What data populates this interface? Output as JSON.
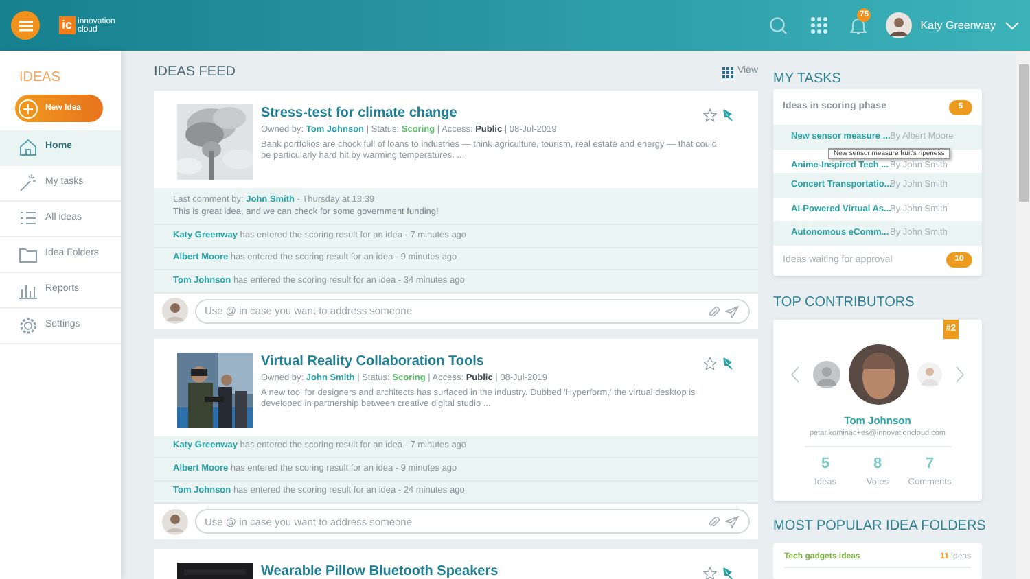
{
  "header": {
    "logo_mark": "ic",
    "logo_text": "innovation cloud",
    "notification_count": "75",
    "user_name": "Katy Greenway"
  },
  "sidebar": {
    "title": "IDEAS",
    "new_button": "New Idea",
    "items": [
      {
        "label": "Home",
        "kind": "home",
        "selected": true
      },
      {
        "label": "My tasks",
        "kind": "tasks",
        "selected": false
      },
      {
        "label": "All ideas",
        "kind": "list",
        "selected": false
      },
      {
        "label": "Idea Folders",
        "kind": "folder",
        "selected": false
      },
      {
        "label": "Reports",
        "kind": "reports",
        "selected": false
      },
      {
        "label": "Settings",
        "kind": "settings",
        "selected": false
      }
    ]
  },
  "feed": {
    "title": "IDEAS FEED",
    "view_label": "View",
    "ideas": [
      {
        "title": "Stress-test for climate change",
        "meta": [
          {
            "kind": "label",
            "text": "Owned by: "
          },
          {
            "kind": "user",
            "text": "Tom Johnson"
          },
          {
            "kind": "label",
            "text": " | Status: "
          },
          {
            "kind": "status",
            "text": "Scoring"
          },
          {
            "kind": "label",
            "text": " | Access: "
          },
          {
            "kind": "strong",
            "text": "Public"
          },
          {
            "kind": "label",
            "text": " | 08-Jul-2019"
          }
        ],
        "description": "Bank portfolios are chock full of loans to industries — think agriculture, tourism, real estate and energy — that could be particularly hard hit by warming temperatures. ...",
        "last_comment": {
          "label": "Last comment by: ",
          "author": "John Smith",
          "time": " - Thursday at 13:39",
          "text": "This is great idea, and we can check for some government funding!"
        },
        "activity": [
          {
            "user": "Katy Greenway",
            "text": " has entered the scoring result for an idea - 7 minutes ago"
          },
          {
            "user": "Albert Moore",
            "text": " has entered the scoring result for an idea - 9 minutes ago"
          },
          {
            "user": "Tom Johnson",
            "text": " has entered the scoring result for an idea - 34 minutes ago"
          }
        ],
        "comment_placeholder": "Use @ in case you want to address someone"
      },
      {
        "title": "Virtual Reality Collaboration Tools",
        "meta": [
          {
            "kind": "label",
            "text": "Owned by: "
          },
          {
            "kind": "user",
            "text": "John Smith"
          },
          {
            "kind": "label",
            "text": " | Status: "
          },
          {
            "kind": "status",
            "text": "Scoring"
          },
          {
            "kind": "label",
            "text": " | Access: "
          },
          {
            "kind": "strong",
            "text": "Public"
          },
          {
            "kind": "label",
            "text": " | 08-Jul-2019"
          }
        ],
        "description": "A new tool for designers and architects has surfaced in the industry. Dubbed 'Hyperform,' the virtual desktop is developed in partnership between creative digital studio ...",
        "activity": [
          {
            "user": "Katy Greenway",
            "text": " has entered the scoring result for an idea - 7 minutes ago"
          },
          {
            "user": "Albert Moore",
            "text": " has entered the scoring result for an idea - 9 minutes ago"
          },
          {
            "user": "Tom Johnson",
            "text": " has entered the scoring result for an idea - 24 minutes ago"
          }
        ],
        "comment_placeholder": "Use @ in case you want to address someone"
      },
      {
        "title": "Wearable Pillow Bluetooth Speakers"
      }
    ]
  },
  "tasks": {
    "title": "MY TASKS",
    "group": "Ideas in scoring phase",
    "group_count": "5",
    "items": [
      {
        "title": "New sensor measure ...",
        "author": "By Albert Moore"
      },
      {
        "title": "Anime-Inspired Tech ...",
        "author": "By John Smith"
      },
      {
        "title": "Concert Transportatio...",
        "author": "By John Smith"
      },
      {
        "title": "AI-Powered Virtual As...",
        "author": "By John Smith"
      },
      {
        "title": "Autonomous eComm...",
        "author": "By John Smith"
      }
    ],
    "tooltip": "New sensor measure fruit's ripeness",
    "footer": "Ideas waiting for approval",
    "footer_count": "10"
  },
  "contributors": {
    "title": "TOP CONTRIBUTORS",
    "rank": "#2",
    "name": "Tom Johnson",
    "email": "petar.kominac+es@innovationcloud.com",
    "stats": [
      {
        "value": "5",
        "label": "Ideas"
      },
      {
        "value": "8",
        "label": "Votes"
      },
      {
        "value": "7",
        "label": "Comments"
      }
    ]
  },
  "folders": {
    "title": "MOST POPULAR IDEA FOLDERS",
    "items": [
      {
        "name": "Tech gadgets ideas",
        "count": "11",
        "unit": "ideas"
      }
    ]
  }
}
